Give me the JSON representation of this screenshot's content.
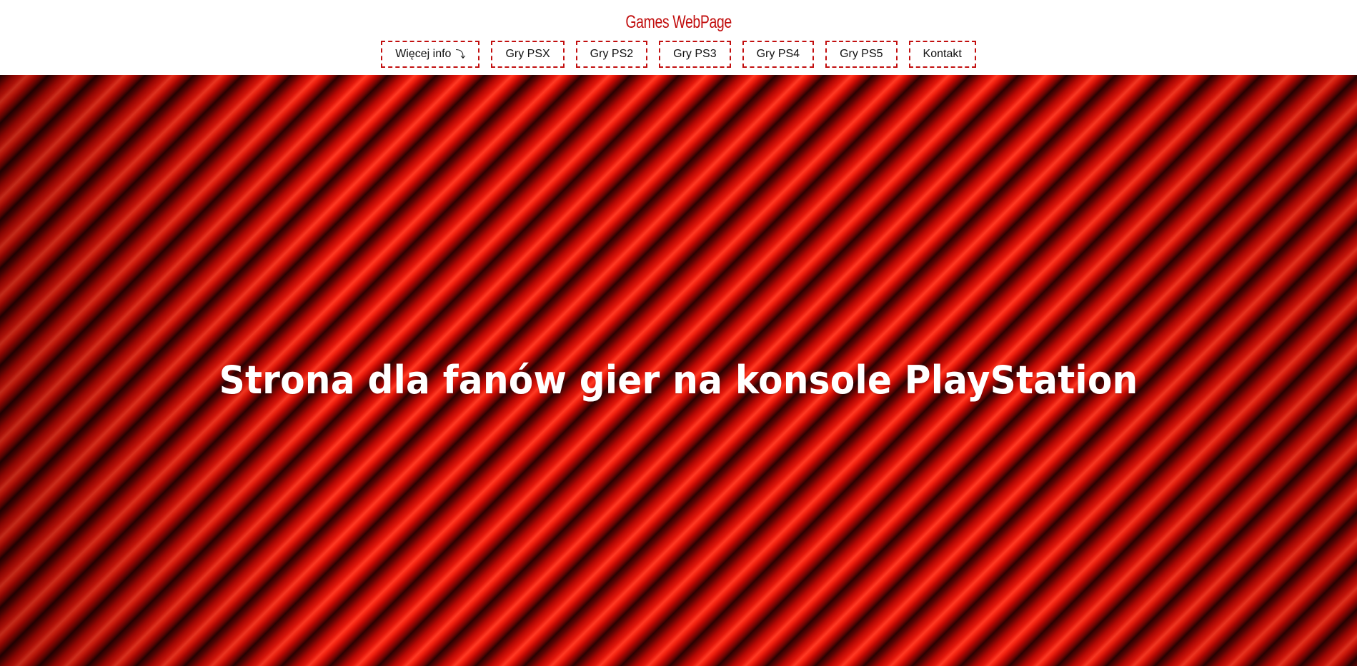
{
  "header": {
    "site_title": "Games WebPage",
    "nav": [
      {
        "label": "Więcej info",
        "icon": "chevron-down-icon"
      },
      {
        "label": "Gry PSX"
      },
      {
        "label": "Gry PS2"
      },
      {
        "label": "Gry PS3"
      },
      {
        "label": "Gry PS4"
      },
      {
        "label": "Gry PS5"
      },
      {
        "label": "Kontakt"
      }
    ]
  },
  "hero": {
    "title": "Strona dla fanów gier na konsole PlayStation"
  },
  "colors": {
    "accent": "#c20f0f",
    "hero_red": "#e3170b",
    "text_dark": "#111111",
    "text_light": "#ffffff"
  }
}
